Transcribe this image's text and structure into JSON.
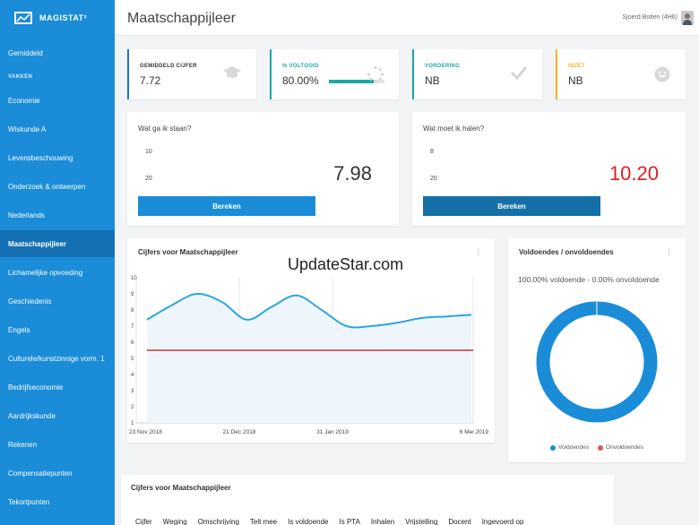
{
  "app": {
    "name": "MAGISTAT²"
  },
  "header": {
    "title": "Maatschappijleer",
    "user": "Sjoerd Bolten (4H6)"
  },
  "sidebar": {
    "items": [
      {
        "label": "Gemiddeld"
      },
      {
        "label": "VAKKEN",
        "section": true
      },
      {
        "label": "Economie"
      },
      {
        "label": "Wiskunde A"
      },
      {
        "label": "Levensbeschouwing"
      },
      {
        "label": "Onderzoek & ontwerpen"
      },
      {
        "label": "Nederlands"
      },
      {
        "label": "Maatschappijleer",
        "active": true
      },
      {
        "label": "Lichamelijke opvoeding"
      },
      {
        "label": "Geschiedenis"
      },
      {
        "label": "Engels"
      },
      {
        "label": "Culturele/kunstzinnige vorm. 1"
      },
      {
        "label": "Bedrijfseconomie"
      },
      {
        "label": "Aardrijkskunde"
      },
      {
        "label": "Rekenen"
      },
      {
        "label": "Compensatiepunten"
      },
      {
        "label": "Tekortpunten"
      }
    ]
  },
  "stats": [
    {
      "label": "GEMIDDELD CIJFER",
      "value": "7.72",
      "color": "#1a73c8",
      "icon": "graduation-cap-icon"
    },
    {
      "label": "% VOLTOOID",
      "value": "80.00%",
      "color": "#1aa9a3",
      "icon": "spinner-icon",
      "progress": 0.8
    },
    {
      "label": "VORDERING",
      "value": "NB",
      "color": "#1aa9a3",
      "icon": "check-icon"
    },
    {
      "label": "INZET",
      "value": "NB",
      "color": "#f0b429",
      "icon": "smile-icon"
    }
  ],
  "calc_left": {
    "title": "Wat ga ik staan?",
    "grade": "10",
    "weight": "20",
    "result": "7.98",
    "button": "Bereken"
  },
  "calc_right": {
    "title": "Wat moet ik halen?",
    "grade": "8",
    "weight": "20",
    "result": "10.20",
    "button": "Bereken"
  },
  "grades_chart": {
    "title": "Cijfers voor Maatschappijleer",
    "watermark": "UpdateStar.com"
  },
  "chart_data": {
    "type": "line",
    "title": "Cijfers voor Maatschappijleer",
    "x_ticks": [
      "23 Nov 2018",
      "21 Dec 2018",
      "31 Jan 2019",
      "6 Mei 2019"
    ],
    "y_ticks": [
      1,
      2,
      3,
      4,
      5,
      6,
      7,
      8,
      9,
      10
    ],
    "ylim": [
      1,
      10
    ],
    "grades_line": [
      7.4,
      8.3,
      9.0,
      8.5,
      7.4,
      8.2,
      8.9,
      8.0,
      7.0,
      7.0,
      7.2,
      7.5,
      7.6,
      7.7
    ],
    "threshold": 5.5,
    "colors": {
      "line": "#2aa6e0",
      "fill": "#eef6fb",
      "threshold": "#b01010"
    }
  },
  "pie": {
    "title": "Voldoendes / onvoldoendes",
    "summary": "100.00% voldoende - 0.00% onvoldoende",
    "legend": [
      {
        "label": "Voldoendes",
        "color": "#1a8cd8"
      },
      {
        "label": "Onvoldoendes",
        "color": "#e55353"
      }
    ],
    "voldoende_fraction": 1.0
  },
  "grades_table": {
    "title": "Cijfers voor Maatschappijleer",
    "columns": [
      "Cijfer",
      "Weging",
      "Omschrijving",
      "Telt mee",
      "Is voldoende",
      "Is PTA",
      "Inhalen",
      "Vrijstelling",
      "Docent",
      "Ingevoerd op"
    ]
  }
}
